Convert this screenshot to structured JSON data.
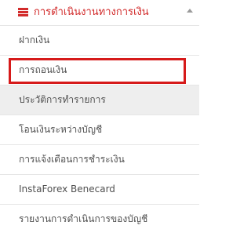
{
  "menu": {
    "title": "การดำเนินงานทางการเงิน",
    "icon": "list-icon",
    "accent_color": "#d22b2b",
    "expanded": true,
    "items": [
      {
        "label": "ฝากเงิน"
      },
      {
        "label": "การถอนเงิน"
      },
      {
        "label": "ประวัติการทำรายการ"
      },
      {
        "label": "โอนเงินระหว่างบัญชี"
      },
      {
        "label": "การแจ้งเตือนการชำระเงิน"
      },
      {
        "label": "InstaForex Benecard"
      },
      {
        "label": "รายงานการดำเนินการของบัญชี"
      }
    ]
  },
  "highlight": {
    "color": "#d61a1a",
    "target_item": "การถอนเงิน"
  }
}
